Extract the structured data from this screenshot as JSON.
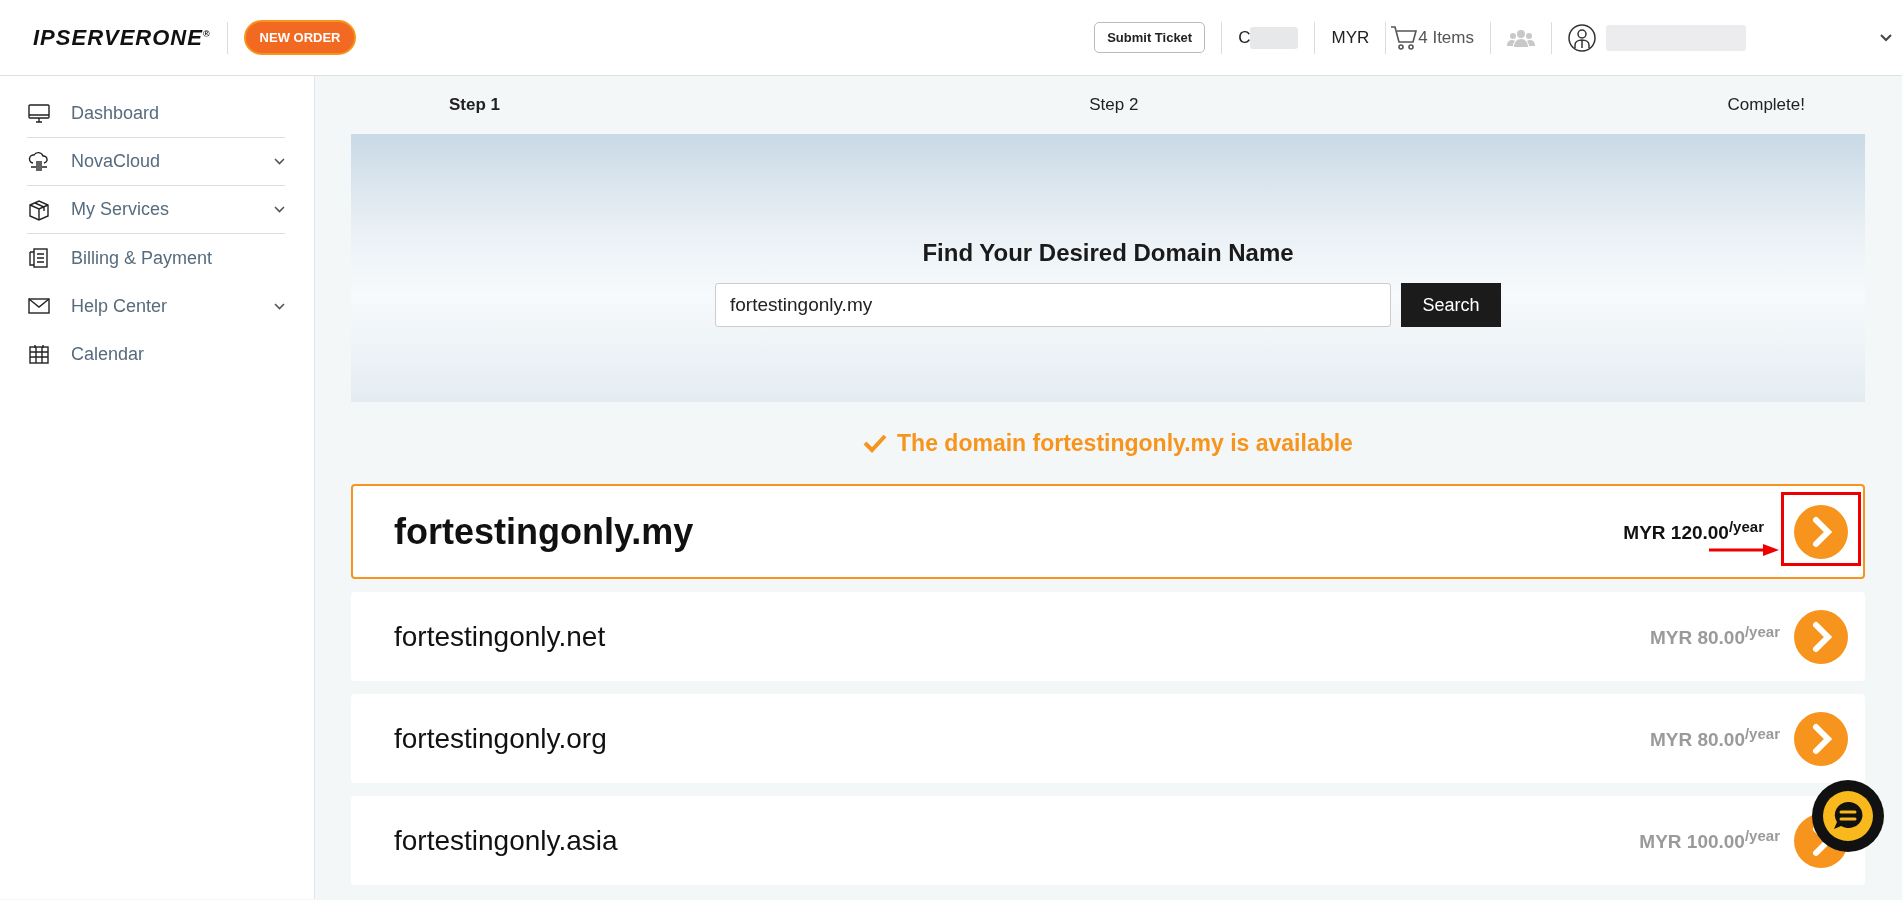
{
  "header": {
    "logo": "IPSERVERONE",
    "logo_mark": "®",
    "new_order": "NEW ORDER",
    "submit_ticket": "Submit Ticket",
    "account_initial": "C",
    "currency": "MYR",
    "cart": "4 Items"
  },
  "sidebar": {
    "items": [
      {
        "label": "Dashboard",
        "expandable": false
      },
      {
        "label": "NovaCloud",
        "expandable": true
      },
      {
        "label": "My Services",
        "expandable": true
      },
      {
        "label": "Billing & Payment",
        "expandable": false
      },
      {
        "label": "Help Center",
        "expandable": true
      },
      {
        "label": "Calendar",
        "expandable": false
      }
    ]
  },
  "steps": [
    {
      "label": "Step 1",
      "selected": true
    },
    {
      "label": "Step 2",
      "selected": false
    },
    {
      "label": "Complete!",
      "selected": false
    }
  ],
  "search": {
    "title": "Find Your Desired Domain Name",
    "value": "fortestingonly.my",
    "button": "Search"
  },
  "availability": "The domain fortestingonly.my is available",
  "domains": [
    {
      "name": "fortestingonly.my",
      "price": "MYR 120.00$^{/year}$",
      "selected": true,
      "annotated": true
    },
    {
      "name": "fortestingonly.net",
      "price": "MYR 80.00$^{/year}$",
      "selected": false,
      "annotated": false
    },
    {
      "name": "fortestingonly.org",
      "price": "MYR 80.00$^{/year}$",
      "selected": false,
      "annotated": false
    },
    {
      "name": "fortestingonly.asia",
      "price": "MYR 100.00$^{/year}$",
      "selected": false,
      "annotated": false
    }
  ]
}
